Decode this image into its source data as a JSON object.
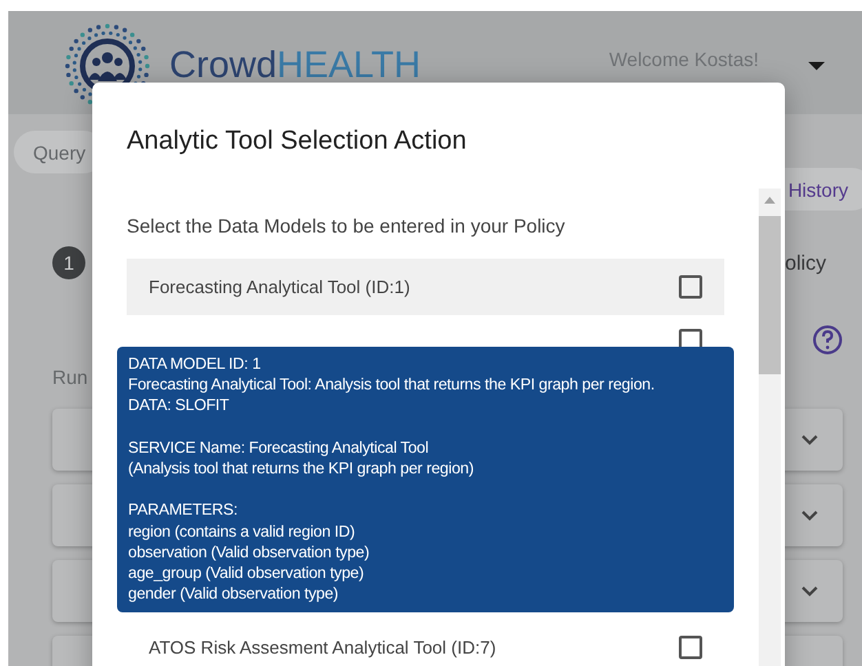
{
  "header": {
    "brand_first": "Crowd",
    "brand_second": "HEALTH",
    "welcome": "Welcome Kostas!"
  },
  "background": {
    "tabs": [
      {
        "label": "Query",
        "selected": false
      },
      {
        "label": "History",
        "selected": true
      }
    ],
    "step_number": "1",
    "step_label": "olicy",
    "run_label": "Run"
  },
  "dialog": {
    "title": "Analytic Tool Selection Action",
    "subtitle": "Select the Data Models to be entered in your Policy",
    "items": [
      {
        "label": "Forecasting Analytical Tool (ID:1)",
        "checked": false,
        "hovered": true
      },
      {
        "checked": false,
        "hovered": false
      },
      {
        "label": "ATOS Risk Assesment Analytical Tool (ID:7)",
        "checked": false,
        "hovered": false
      }
    ]
  },
  "tooltip": {
    "paragraphs": [
      [
        "DATA MODEL ID: 1",
        "Forecasting Analytical Tool: Analysis tool that returns the KPI graph per region.",
        "DATA: SLOFIT"
      ],
      [
        "SERVICE Name: Forecasting Analytical Tool",
        "(Analysis tool that returns the KPI graph per region)"
      ],
      [
        "PARAMETERS:",
        "region (contains a valid region ID)",
        "observation (Valid observation type)",
        "age_group (Valid observation type)",
        "gender (Valid observation type)"
      ]
    ]
  }
}
